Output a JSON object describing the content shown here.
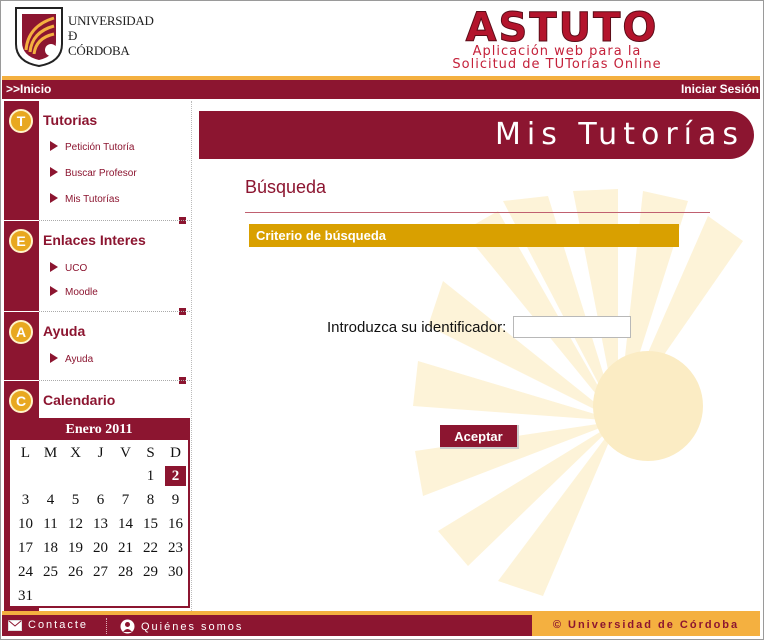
{
  "header": {
    "university_lines": [
      "UNIVERSIDAD",
      "Đ",
      "CÓRDOBA"
    ],
    "app_title": "ASTUTO",
    "app_subtitle_line1": "Aplicación web para la",
    "app_subtitle_line2": "Solicitud de TUTorías Online"
  },
  "nav": {
    "home": ">>Inicio",
    "login": "Iniciar Sesión"
  },
  "sidebar": {
    "sections": [
      {
        "badge": "T",
        "title": "Tutorias",
        "links": [
          "Petición Tutoría",
          "Buscar Profesor",
          "Mis Tutorías"
        ]
      },
      {
        "badge": "E",
        "title": "Enlaces Interes",
        "links": [
          "UCO",
          "Moodle"
        ]
      },
      {
        "badge": "A",
        "title": "Ayuda",
        "links": [
          "Ayuda"
        ]
      },
      {
        "badge": "C",
        "title": "Calendario",
        "links": []
      }
    ]
  },
  "calendar": {
    "month": "Enero 2011",
    "weekdays": [
      "L",
      "M",
      "X",
      "J",
      "V",
      "S",
      "D"
    ],
    "first_weekday_index": 5,
    "days_in_month": 31,
    "today": 2
  },
  "main": {
    "banner_title": "Mis Tutorías",
    "section_heading": "Búsqueda",
    "criteria_title": "Criterio de búsqueda",
    "id_label": "Introduzca su identificador:",
    "id_value": "",
    "accept_label": "Aceptar"
  },
  "footer": {
    "contact": "Contacte",
    "about": "Quiénes somos",
    "copyright": "© Universidad de Córdoba"
  },
  "colors": {
    "brand": "#8c1530",
    "accent": "#f4b040",
    "criteria": "#d9a000"
  }
}
